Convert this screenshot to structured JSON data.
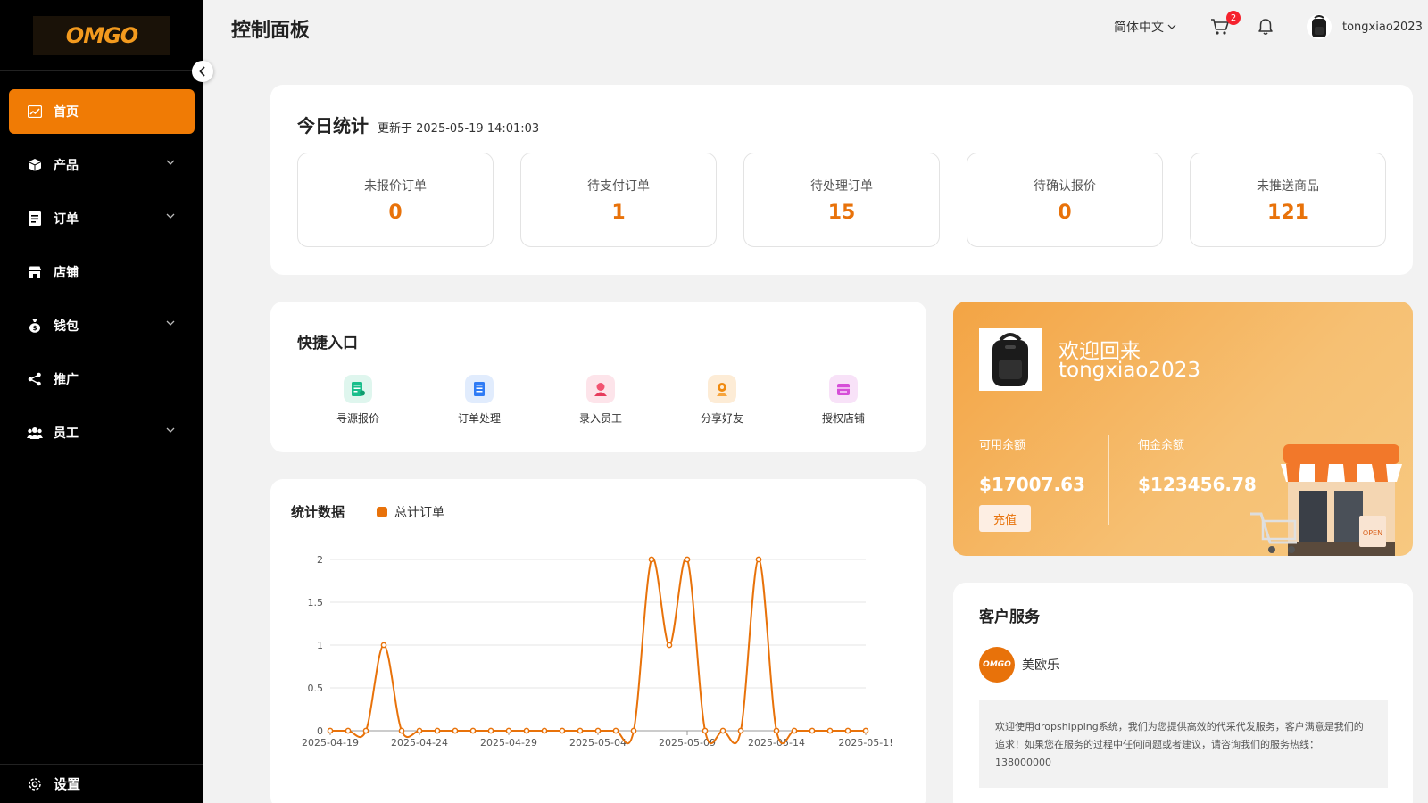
{
  "sidebar": {
    "logo_text": "OMGO",
    "items": [
      {
        "label": "首页",
        "icon": "chart-icon",
        "active": true
      },
      {
        "label": "产品",
        "icon": "box-icon"
      },
      {
        "label": "订单",
        "icon": "list-icon"
      },
      {
        "label": "店铺",
        "icon": "store-icon"
      },
      {
        "label": "钱包",
        "icon": "money-bag-icon"
      },
      {
        "label": "推广",
        "icon": "share-icon"
      },
      {
        "label": "员工",
        "icon": "users-icon"
      }
    ],
    "settings_label": "设置"
  },
  "header": {
    "title": "控制面板",
    "language": "简体中文",
    "cart_count": "2",
    "username": "tongxiao2023"
  },
  "stats": {
    "title": "今日统计",
    "updated": "更新于 2025-05-19 14:01:03",
    "items": [
      {
        "label": "未报价订单",
        "value": "0"
      },
      {
        "label": "待支付订单",
        "value": "1"
      },
      {
        "label": "待处理订单",
        "value": "15"
      },
      {
        "label": "待确认报价",
        "value": "0"
      },
      {
        "label": "未推送商品",
        "value": "121"
      }
    ]
  },
  "quick": {
    "title": "快捷入口",
    "items": [
      {
        "label": "寻源报价",
        "icon": "sourcing-icon",
        "color": "#19be8b",
        "bg": "#dff6ee"
      },
      {
        "label": "订单处理",
        "icon": "order-icon",
        "color": "#2f7bf5",
        "bg": "#e1ecfd"
      },
      {
        "label": "录入员工",
        "icon": "staff-icon",
        "color": "#f25472",
        "bg": "#fde4ea"
      },
      {
        "label": "分享好友",
        "icon": "share-friend-icon",
        "color": "#f08a10",
        "bg": "#fdecd6"
      },
      {
        "label": "授权店铺",
        "icon": "auth-store-icon",
        "color": "#d64fd8",
        "bg": "#f8e2f8"
      }
    ]
  },
  "welcome": {
    "title": "欢迎回来",
    "username": "tongxiao2023",
    "available_label": "可用余额",
    "available_value": "$17007.63",
    "commission_label": "佣金余额",
    "commission_value": "$123456.78",
    "recharge_label": "充值",
    "open_sign": "OPEN"
  },
  "chart_data": {
    "type": "line",
    "title": "统计数据",
    "series": [
      {
        "name": "总计订单",
        "values": [
          0,
          0,
          0,
          1,
          0,
          0,
          0,
          0,
          0,
          0,
          0,
          0,
          0,
          0,
          0,
          0,
          0,
          0,
          2,
          1,
          2,
          0,
          0,
          0,
          2,
          0,
          0,
          0,
          0,
          0,
          0
        ]
      }
    ],
    "x": [
      "2025-04-19",
      "2025-04-20",
      "2025-04-21",
      "2025-04-22",
      "2025-04-23",
      "2025-04-24",
      "2025-04-25",
      "2025-04-26",
      "2025-04-27",
      "2025-04-28",
      "2025-04-29",
      "2025-04-30",
      "2025-05-01",
      "2025-05-02",
      "2025-05-03",
      "2025-05-04",
      "2025-05-05",
      "2025-05-06",
      "2025-05-07",
      "2025-05-08",
      "2025-05-09",
      "2025-05-10",
      "2025-05-11",
      "2025-05-12",
      "2025-05-13",
      "2025-05-14",
      "2025-05-15",
      "2025-05-16",
      "2025-05-17",
      "2025-05-18",
      "2025-05-19"
    ],
    "x_tick_labels": [
      "2025-04-19",
      "2025-04-24",
      "2025-04-29",
      "2025-05-04",
      "2025-05-09",
      "2025-05-14",
      "2025-05-1!"
    ],
    "y_ticks": [
      "0",
      "0.5",
      "1",
      "1.5",
      "2"
    ],
    "ylim": [
      0,
      2
    ],
    "grid": true,
    "color": "#e8720a"
  },
  "service": {
    "title": "客户服务",
    "agent_name": "美欧乐",
    "agent_logo": "OMGO",
    "message": "欢迎使用dropshipping系统，我们为您提供高效的代采代发服务，客户满意是我们的追求！如果您在服务的过程中任何问题或者建议，请咨询我们的服务热线：138000000"
  }
}
